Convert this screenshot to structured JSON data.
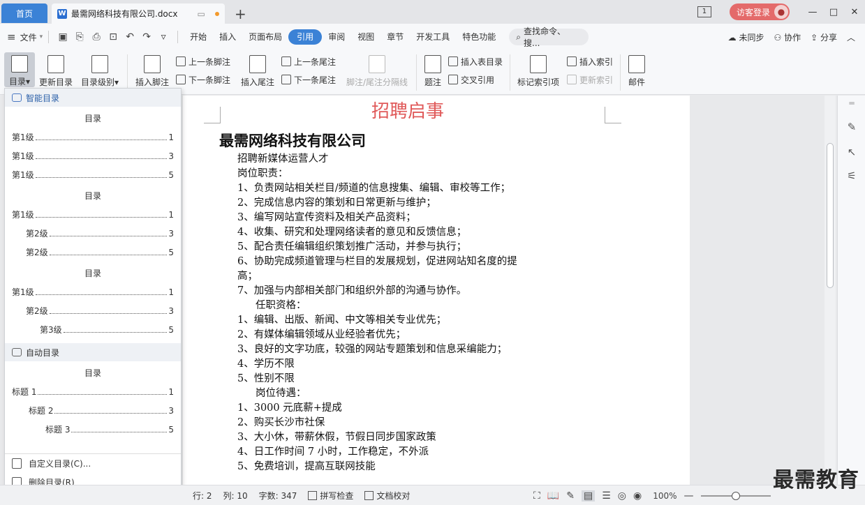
{
  "titlebar": {
    "home_tab": "首页",
    "doc_tab": "最需网络科技有限公司.docx",
    "doc_icon": "W",
    "add_tab": "+",
    "page_indicator": "1",
    "guest_login": "访客登录",
    "minimize": "—",
    "restore": "□",
    "close": "✕"
  },
  "menubar": {
    "file": "文件",
    "tabs": [
      "开始",
      "插入",
      "页面布局",
      "引用",
      "审阅",
      "视图",
      "章节",
      "开发工具",
      "特色功能"
    ],
    "active_tab": "引用",
    "search_placeholder": "查找命令、搜...",
    "sync": "未同步",
    "collab": "协作",
    "share": "分享"
  },
  "ribbon": {
    "toc": "目录",
    "update_toc": "更新目录",
    "toc_level": "目录级别",
    "insert_footnote": "插入脚注",
    "prev_footnote": "上一条脚注",
    "next_footnote": "下一条脚注",
    "insert_endnote": "插入尾注",
    "prev_endnote": "上一条尾注",
    "next_endnote": "下一条尾注",
    "separator_line": "脚注/尾注分隔线",
    "caption": "题注",
    "insert_table_of_figures": "插入表目录",
    "cross_reference": "交叉引用",
    "mark_index": "标记索引项",
    "insert_index": "插入索引",
    "update_index": "更新索引",
    "mail": "邮件"
  },
  "toc_panel": {
    "smart_header": "智能目录",
    "blocks": [
      {
        "title": "目录",
        "rows": [
          {
            "label": "第1级",
            "page": "1",
            "level": 1
          },
          {
            "label": "第1级",
            "page": "3",
            "level": 1
          },
          {
            "label": "第1级",
            "page": "5",
            "level": 1
          }
        ]
      },
      {
        "title": "目录",
        "rows": [
          {
            "label": "第1级",
            "page": "1",
            "level": 1
          },
          {
            "label": "第2级",
            "page": "3",
            "level": 2
          },
          {
            "label": "第2级",
            "page": "5",
            "level": 2
          }
        ]
      },
      {
        "title": "目录",
        "rows": [
          {
            "label": "第1级",
            "page": "1",
            "level": 1
          },
          {
            "label": "第2级",
            "page": "3",
            "level": 2
          },
          {
            "label": "第3级",
            "page": "5",
            "level": 3
          }
        ]
      }
    ],
    "auto_header": "自动目录",
    "auto_block": {
      "title": "目录",
      "rows": [
        {
          "label": "标题 1",
          "page": "1",
          "level": 1
        },
        {
          "label": "标题 2",
          "page": "3",
          "level": 2
        },
        {
          "label": "标题 3",
          "page": "5",
          "level": 3
        }
      ]
    },
    "custom_toc": "自定义目录(C)...",
    "delete_toc": "删除目录(R)"
  },
  "document": {
    "title": "招聘启事",
    "company": "最需网络科技有限公司",
    "lines": [
      {
        "text": "招聘新媒体运营人才",
        "indent": false
      },
      {
        "text": "岗位职责：",
        "indent": false
      },
      {
        "text": "1、负责网站相关栏目/频道的信息搜集、编辑、审校等工作；",
        "indent": false
      },
      {
        "text": "2、完成信息内容的策划和日常更新与维护；",
        "indent": false
      },
      {
        "text": "3、编写网站宣传资料及相关产品资料；",
        "indent": false
      },
      {
        "text": "4、收集、研究和处理网络读者的意见和反馈信息；",
        "indent": false
      },
      {
        "text": "5、配合责任编辑组织策划推广活动，并参与执行；",
        "indent": false
      },
      {
        "text": "6、协助完成频道管理与栏目的发展规划，促进网站知名度的提",
        "indent": false
      },
      {
        "text": "高；",
        "indent": false
      },
      {
        "text": "7、加强与内部相关部门和组织外部的沟通与协作。",
        "indent": false
      },
      {
        "text": "任职资格：",
        "indent": true
      },
      {
        "text": "1、编辑、出版、新闻、中文等相关专业优先；",
        "indent": false
      },
      {
        "text": "2、有媒体编辑领域从业经验者优先；",
        "indent": false
      },
      {
        "text": "3、良好的文字功底，较强的网站专题策划和信息采编能力；",
        "indent": false
      },
      {
        "text": "4、学历不限",
        "indent": false
      },
      {
        "text": "5、性别不限",
        "indent": false
      },
      {
        "text": "岗位待遇：",
        "indent": true
      },
      {
        "text": "1、3000 元底薪+提成",
        "indent": false
      },
      {
        "text": "2、购买长沙市社保",
        "indent": false
      },
      {
        "text": "3、大小休，带薪休假，节假日同步国家政策",
        "indent": false
      },
      {
        "text": "4、日工作时间 7 小时，工作稳定，不外派",
        "indent": false
      },
      {
        "text": "5、免费培训，提高互联网技能",
        "indent": false
      }
    ]
  },
  "statusbar": {
    "row": "行: 2",
    "col": "列: 10",
    "word_count": "字数: 347",
    "spell_check": "拼写检查",
    "doc_proof": "文档校对",
    "zoom": "100%",
    "zoom_minus": "—",
    "zoom_plus": "+"
  },
  "watermark": "最需教育",
  "colors": {
    "accent": "#3b82d6",
    "title_red": "#e05a5a",
    "guest_red": "#e46a6a"
  }
}
